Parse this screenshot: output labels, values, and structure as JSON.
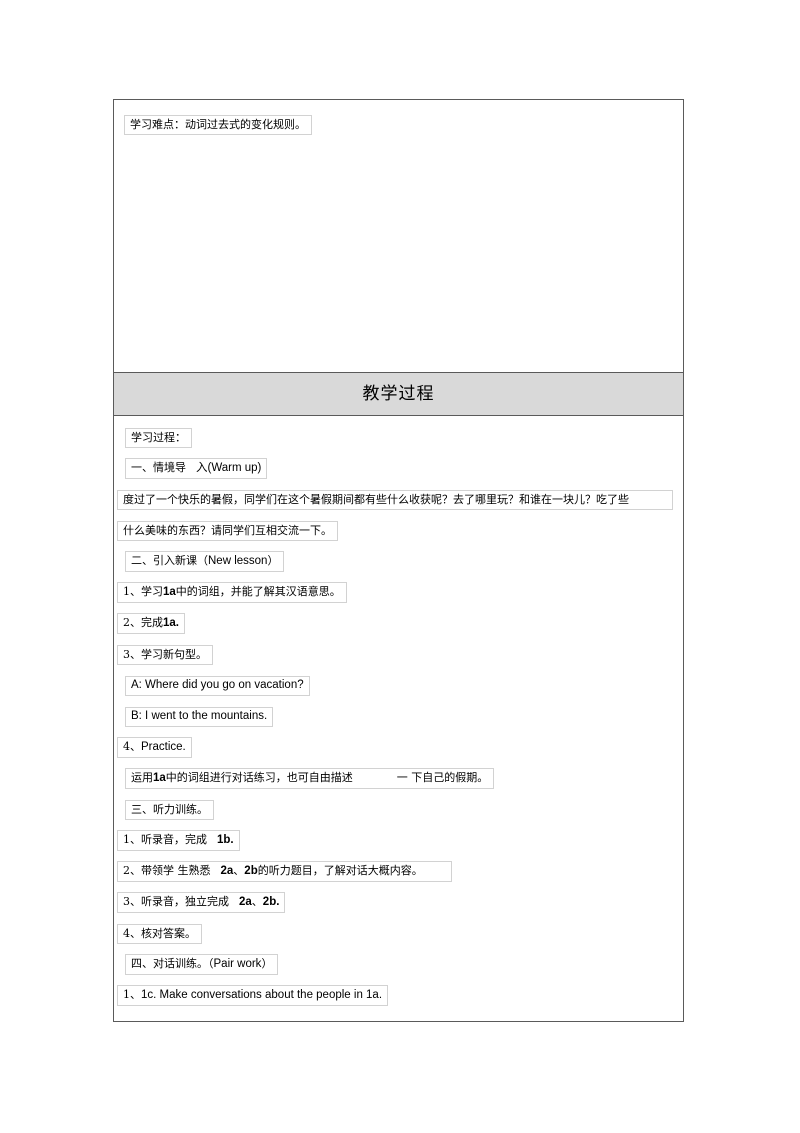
{
  "document": {
    "difficulty_note": "学习难点：动词过去式的变化规则。",
    "section_header": "教学过程",
    "steps": {
      "process_label": "学习过程：",
      "warmup_heading_cn": "一、情境导",
      "warmup_heading_en": "入(Warm up)",
      "warmup_text_line1": "度过了一个快乐的暑假，同学们在这个暑假期间都有些什么收获呢？去了哪里玩？和谁在一块儿？吃了些",
      "warmup_text_line2": "什么美味的东西？请同学们互相交流一下。",
      "newlesson_heading_cn": "二、引入新课（",
      "newlesson_heading_en": "New lesson",
      "newlesson_heading_close": "）",
      "item_2_1_a": "1、学习",
      "item_2_1_b": "1a",
      "item_2_1_c": "中的词组，并能了解其汉语意思。",
      "item_2_2_a": "2、完成",
      "item_2_2_b": "1a.",
      "item_2_3": "3、学习新句型。",
      "dialogue_a": "A: Where did you go on vacation?",
      "dialogue_b": "B: I went to the mountains.",
      "item_2_4_a": "4、",
      "item_2_4_b": "Practice.",
      "practice_text_a": "运用",
      "practice_text_b": "1a",
      "practice_text_c": "中的词组进行对话练习，也可自由描述",
      "practice_text_d": "一 下自己的假期。",
      "listening_heading": "三、听力训练。",
      "item_3_1_a": "1、听录音，完成",
      "item_3_1_b": "1b.",
      "item_3_2_a": "2、带领学 生熟悉",
      "item_3_2_b": "2a",
      "item_3_2_c": "、",
      "item_3_2_d": "2b",
      "item_3_2_e": "的听力题目，了解对话大概内容。",
      "item_3_3_a": "3、听录音，独立完成",
      "item_3_3_b": "2a",
      "item_3_3_c": "、",
      "item_3_3_d": "2b.",
      "item_3_4": "4、核对答案。",
      "pairwork_heading_cn": "四、对话训练。（",
      "pairwork_heading_en": "Pair work",
      "pairwork_heading_close": "）",
      "item_4_1_a": "1、",
      "item_4_1_b": "1c. Make conversations about the people in 1a."
    }
  },
  "colors": {
    "table_border": "#5a5a5a",
    "field_border": "#d2d2d2",
    "header_band": "#d9d9d9",
    "text": "#000000"
  }
}
